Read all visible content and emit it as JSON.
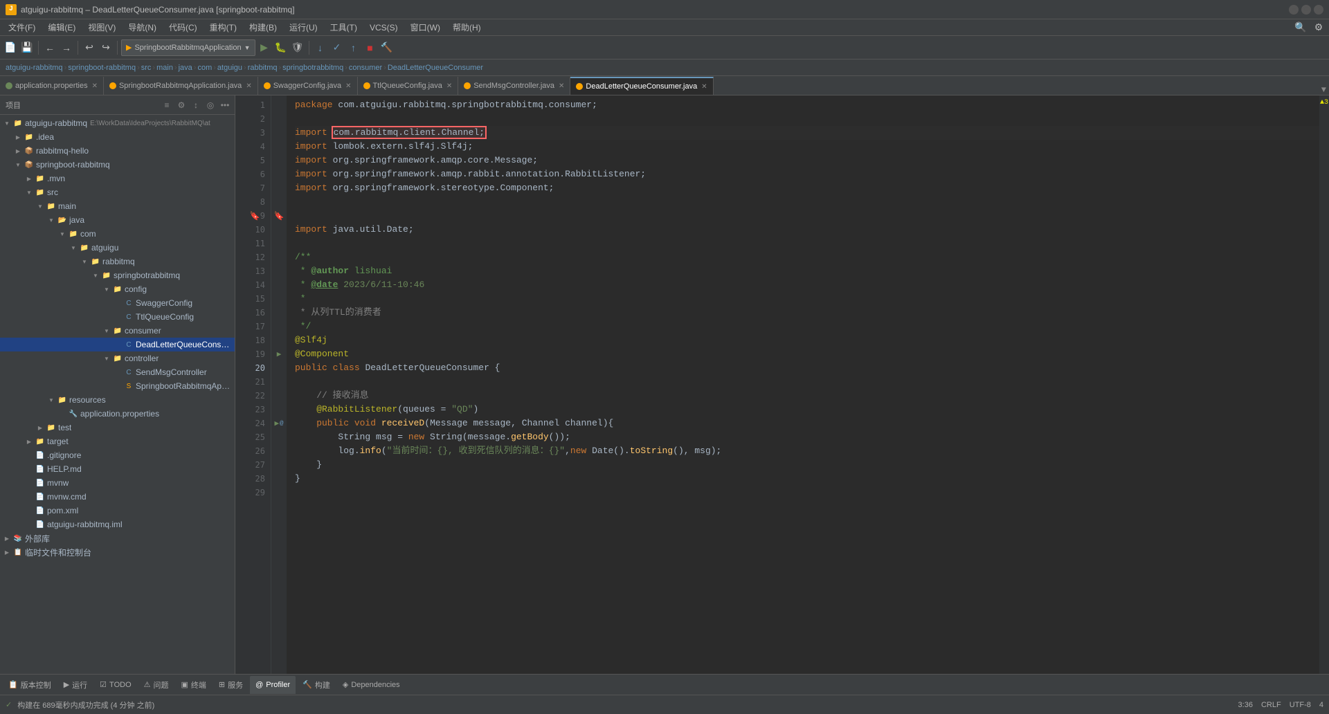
{
  "window": {
    "title": "atguigu-rabbitmq – DeadLetterQueueConsumer.java [springboot-rabbitmq]",
    "min_label": "─",
    "max_label": "□",
    "close_label": "✕"
  },
  "menu": {
    "items": [
      "文件(F)",
      "编辑(E)",
      "视图(V)",
      "导航(N)",
      "代码(C)",
      "重构(T)",
      "构建(B)",
      "运行(U)",
      "工具(T)",
      "VCS(S)",
      "窗口(W)",
      "帮助(H)"
    ]
  },
  "toolbar": {
    "project_dropdown": "SpringbootRabbitmqApplication",
    "run_config_icon": "▶",
    "build_icon": "🔨"
  },
  "breadcrumb": {
    "items": [
      "atguigu-rabbitmq",
      "springboot-rabbitmq",
      "src",
      "main",
      "java",
      "com",
      "atguigu",
      "rabbitmq",
      "springbotrabbitmq",
      "consumer",
      "DeadLetterQueueConsumer"
    ]
  },
  "tabs": [
    {
      "name": "application.properties",
      "icon": "green",
      "active": false,
      "modified": false
    },
    {
      "name": "SpringbootRabbitmqApplication.java",
      "icon": "orange",
      "active": false,
      "modified": false
    },
    {
      "name": "SwaggerConfig.java",
      "icon": "orange",
      "active": false,
      "modified": false
    },
    {
      "name": "TtlQueueConfig.java",
      "icon": "orange",
      "active": false,
      "modified": false
    },
    {
      "name": "SendMsgController.java",
      "icon": "orange",
      "active": false,
      "modified": false
    },
    {
      "name": "DeadLetterQueueConsumer.java",
      "icon": "orange",
      "active": true,
      "modified": false
    }
  ],
  "sidebar": {
    "title": "项目",
    "tree": [
      {
        "level": 0,
        "label": "atguigu-rabbitmq",
        "type": "root",
        "expanded": true,
        "arrow": "▼",
        "icon_color": "#6897bb"
      },
      {
        "level": 1,
        "label": ".idea",
        "type": "folder",
        "expanded": false,
        "arrow": "▶",
        "icon_color": "#ffa500"
      },
      {
        "level": 1,
        "label": "rabbitmq-hello",
        "type": "folder",
        "expanded": false,
        "arrow": "▶",
        "icon_color": "#ffa500"
      },
      {
        "level": 1,
        "label": "springboot-rabbitmq",
        "type": "folder",
        "expanded": true,
        "arrow": "▼",
        "icon_color": "#6897bb"
      },
      {
        "level": 2,
        "label": ".mvn",
        "type": "folder",
        "expanded": false,
        "arrow": "▶",
        "icon_color": "#888"
      },
      {
        "level": 2,
        "label": "src",
        "type": "folder",
        "expanded": true,
        "arrow": "▼",
        "icon_color": "#ffa500"
      },
      {
        "level": 3,
        "label": "main",
        "type": "folder",
        "expanded": true,
        "arrow": "▼",
        "icon_color": "#ffa500"
      },
      {
        "level": 4,
        "label": "java",
        "type": "folder",
        "expanded": true,
        "arrow": "▼",
        "icon_color": "#6897bb"
      },
      {
        "level": 5,
        "label": "com",
        "type": "folder",
        "expanded": true,
        "arrow": "▼",
        "icon_color": "#ffa500"
      },
      {
        "level": 6,
        "label": "atguigu",
        "type": "folder",
        "expanded": true,
        "arrow": "▼",
        "icon_color": "#ffa500"
      },
      {
        "level": 7,
        "label": "rabbitmq",
        "type": "folder",
        "expanded": true,
        "arrow": "▼",
        "icon_color": "#ffa500"
      },
      {
        "level": 8,
        "label": "springbotrabbitmq",
        "type": "folder",
        "expanded": true,
        "arrow": "▼",
        "icon_color": "#ffa500"
      },
      {
        "level": 9,
        "label": "config",
        "type": "folder",
        "expanded": true,
        "arrow": "▼",
        "icon_color": "#ffa500"
      },
      {
        "level": 10,
        "label": "SwaggerConfig",
        "type": "class",
        "icon_color": "#6897bb"
      },
      {
        "level": 10,
        "label": "TtlQueueConfig",
        "type": "class",
        "icon_color": "#6897bb"
      },
      {
        "level": 9,
        "label": "consumer",
        "type": "folder",
        "expanded": true,
        "arrow": "▼",
        "icon_color": "#ffa500"
      },
      {
        "level": 10,
        "label": "DeadLetterQueueConsumer",
        "type": "class",
        "icon_color": "#6897bb",
        "selected": true
      },
      {
        "level": 9,
        "label": "controller",
        "type": "folder",
        "expanded": true,
        "arrow": "▼",
        "icon_color": "#ffa500"
      },
      {
        "level": 10,
        "label": "SendMsgController",
        "type": "class",
        "icon_color": "#6897bb"
      },
      {
        "level": 10,
        "label": "SpringbootRabbitmqApplication",
        "type": "class",
        "icon_color": "#ffa500"
      },
      {
        "level": 4,
        "label": "resources",
        "type": "folder",
        "expanded": true,
        "arrow": "▼",
        "icon_color": "#ffa500"
      },
      {
        "level": 5,
        "label": "application.properties",
        "type": "properties",
        "icon_color": "#6a8759"
      },
      {
        "level": 3,
        "label": "test",
        "type": "folder",
        "expanded": false,
        "arrow": "▶",
        "icon_color": "#ffa500"
      },
      {
        "level": 2,
        "label": "target",
        "type": "folder",
        "expanded": false,
        "arrow": "▶",
        "icon_color": "#888"
      },
      {
        "level": 2,
        "label": ".gitignore",
        "type": "file",
        "icon_color": "#888"
      },
      {
        "level": 2,
        "label": "HELP.md",
        "type": "file",
        "icon_color": "#888"
      },
      {
        "level": 2,
        "label": "mvnw",
        "type": "file",
        "icon_color": "#888"
      },
      {
        "level": 2,
        "label": "mvnw.cmd",
        "type": "file",
        "icon_color": "#888"
      },
      {
        "level": 2,
        "label": "pom.xml",
        "type": "file",
        "icon_color": "#e88734"
      },
      {
        "level": 2,
        "label": "atguigu-rabbitmq.iml",
        "type": "file",
        "icon_color": "#888"
      },
      {
        "level": 0,
        "label": "外部库",
        "type": "folder",
        "expanded": false,
        "arrow": "▶",
        "icon_color": "#888"
      },
      {
        "level": 0,
        "label": "临时文件和控制台",
        "type": "folder",
        "expanded": false,
        "arrow": "▶",
        "icon_color": "#888"
      }
    ]
  },
  "editor": {
    "filename": "DeadLetterQueueConsumer.java",
    "lines": [
      {
        "num": 1,
        "content": "package com.atguigu.rabbitmq.springbotrabbitmq.consumer;",
        "type": "normal"
      },
      {
        "num": 2,
        "content": "",
        "type": "normal"
      },
      {
        "num": 3,
        "content": "import com.rabbitmq.client.Channel;",
        "type": "import-highlighted"
      },
      {
        "num": 4,
        "content": "import lombok.extern.slf4j.Slf4j;",
        "type": "import"
      },
      {
        "num": 5,
        "content": "import org.springframework.amqp.core.Message;",
        "type": "import"
      },
      {
        "num": 6,
        "content": "import org.springframework.amqp.rabbit.annotation.RabbitListener;",
        "type": "import"
      },
      {
        "num": 7,
        "content": "import org.springframework.stereotype.Component;",
        "type": "import"
      },
      {
        "num": 8,
        "content": "",
        "type": "normal"
      },
      {
        "num": 9,
        "content": "",
        "type": "bookmark"
      },
      {
        "num": 10,
        "content": "import java.util.Date;",
        "type": "import"
      },
      {
        "num": 11,
        "content": "",
        "type": "normal"
      },
      {
        "num": 12,
        "content": "/**",
        "type": "comment"
      },
      {
        "num": 13,
        "content": " * @author lishuai",
        "type": "comment-author"
      },
      {
        "num": 14,
        "content": " * @date 2023/6/11-10:46",
        "type": "comment-date"
      },
      {
        "num": 15,
        "content": " *",
        "type": "comment"
      },
      {
        "num": 16,
        "content": " * 从列TTL的消费者",
        "type": "comment-chinese"
      },
      {
        "num": 17,
        "content": " */",
        "type": "comment"
      },
      {
        "num": 18,
        "content": "@Slf4j",
        "type": "annotation"
      },
      {
        "num": 19,
        "content": "@Component",
        "type": "annotation"
      },
      {
        "num": 20,
        "content": "public class DeadLetterQueueConsumer {",
        "type": "class-decl"
      },
      {
        "num": 21,
        "content": "",
        "type": "normal"
      },
      {
        "num": 22,
        "content": "    // 接收消息",
        "type": "comment-inline"
      },
      {
        "num": 23,
        "content": "    @RabbitListener(queues = \"QD\")",
        "type": "annotation-method"
      },
      {
        "num": 24,
        "content": "    public void receiveD(Message message, Channel channel){",
        "type": "method-decl"
      },
      {
        "num": 25,
        "content": "        String msg = new String(message.getBody());",
        "type": "code"
      },
      {
        "num": 26,
        "content": "        log.info(\"当前时间：{}, 收到死信队列的消息：{}\",new Date().toString(), msg);",
        "type": "code-log"
      },
      {
        "num": 27,
        "content": "    }",
        "type": "normal"
      },
      {
        "num": 28,
        "content": "}",
        "type": "normal"
      },
      {
        "num": 29,
        "content": "",
        "type": "normal"
      }
    ]
  },
  "bottom_tabs": [
    {
      "label": "版本控制",
      "icon": "📋"
    },
    {
      "label": "运行",
      "icon": "▶"
    },
    {
      "label": "TODO",
      "icon": "☑"
    },
    {
      "label": "问题",
      "icon": "⚠"
    },
    {
      "label": "终端",
      "icon": "▣"
    },
    {
      "label": "服务",
      "icon": "⊞"
    },
    {
      "label": "Profiler",
      "icon": "@",
      "active": true
    },
    {
      "label": "构建",
      "icon": "🔨"
    },
    {
      "label": "Dependencies",
      "icon": "◈"
    }
  ],
  "status_bar": {
    "build_message": "构建在 689毫秒内成功完成 (4 分钟 之前)",
    "position": "3:36",
    "line_sep": "CRLF",
    "encoding": "UTF-8",
    "indent": "4"
  },
  "colors": {
    "accent": "#6897bb",
    "keyword": "#cc7832",
    "string": "#6a8759",
    "comment": "#808080",
    "annotation": "#bbb529",
    "background": "#2b2b2b",
    "sidebar_bg": "#3c3f41",
    "selected": "#214283",
    "warning": "#e6e600"
  }
}
